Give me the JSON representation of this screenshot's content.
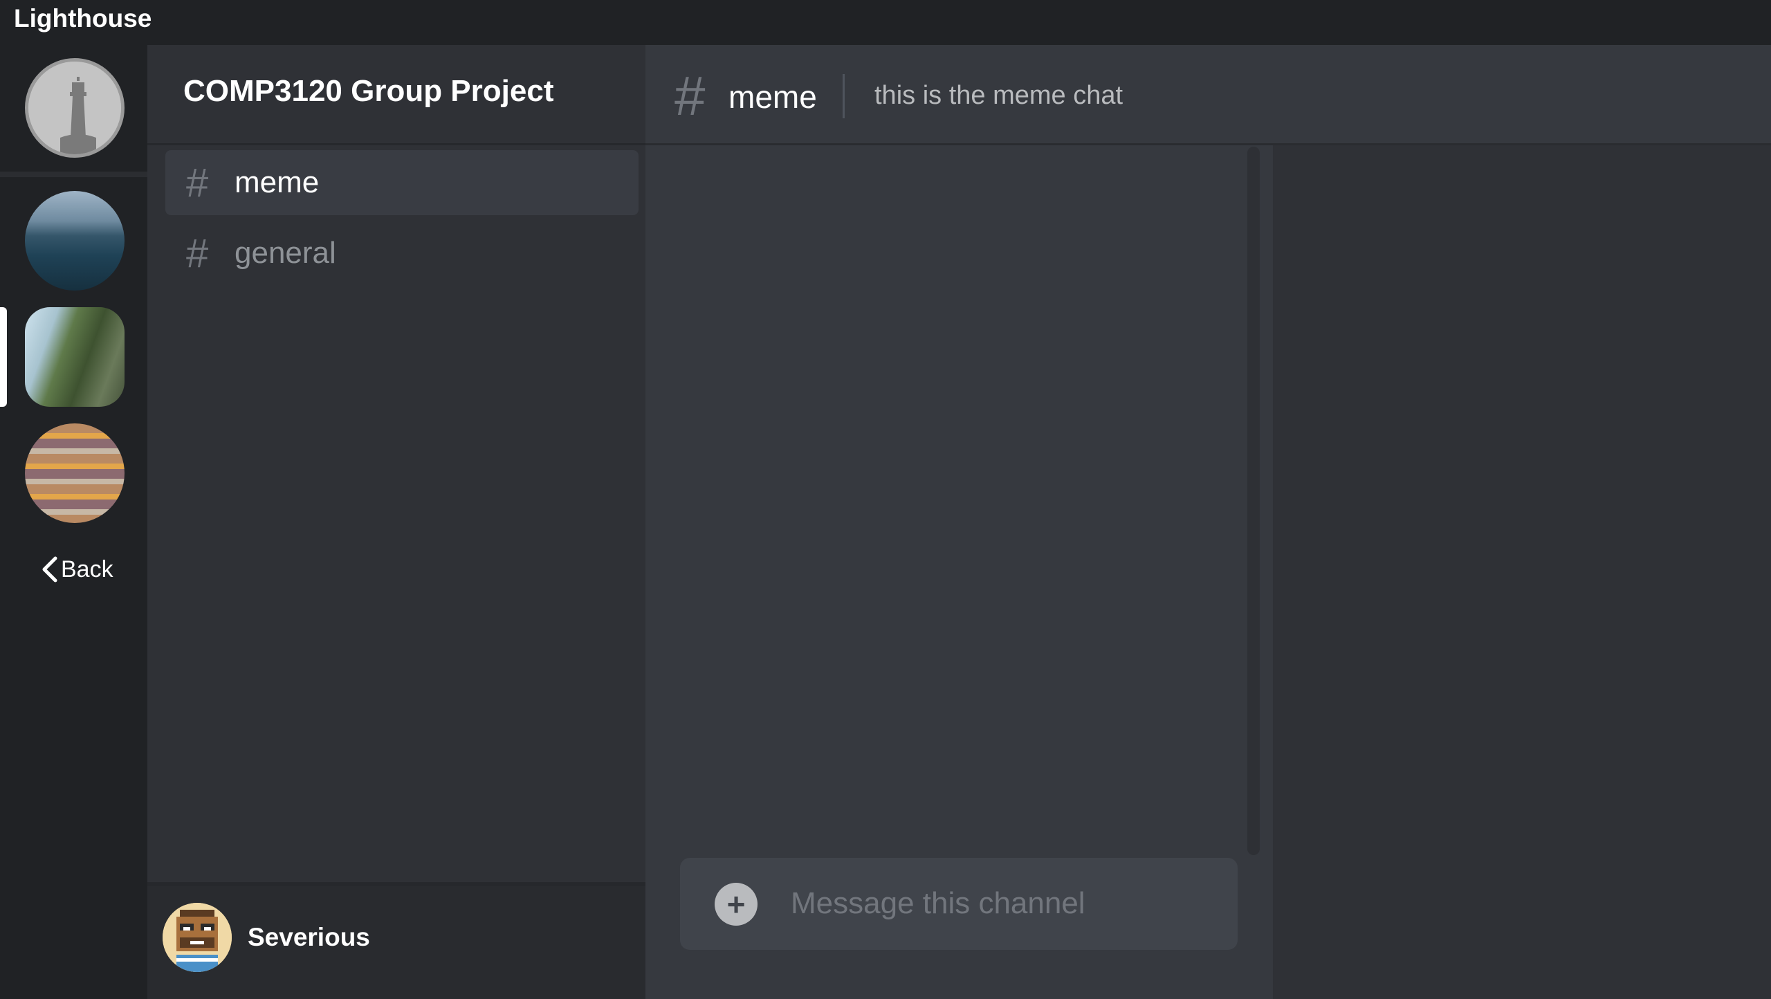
{
  "app": {
    "title": "Lighthouse"
  },
  "rail": {
    "servers": [
      {
        "name": "ocean-server",
        "icon": "ocean-image"
      },
      {
        "name": "forest-road-server",
        "icon": "forest-image"
      },
      {
        "name": "stripes-server",
        "icon": "stripes-image"
      }
    ],
    "back_label": "Back"
  },
  "sidebar": {
    "server_name": "COMP3120 Group Project",
    "channels": [
      {
        "hash": "#",
        "label": "meme",
        "active": true
      },
      {
        "hash": "#",
        "label": "general",
        "active": false
      }
    ],
    "user": {
      "name": "Severious"
    }
  },
  "chat": {
    "hash": "#",
    "channel_name": "meme",
    "topic": "this is the meme chat",
    "composer": {
      "add_label": "+",
      "placeholder": "Message this channel"
    }
  },
  "colors": {
    "background": "#36393f",
    "sidebar": "#2f3136",
    "rail": "#202225",
    "active_channel": "#393c43"
  }
}
